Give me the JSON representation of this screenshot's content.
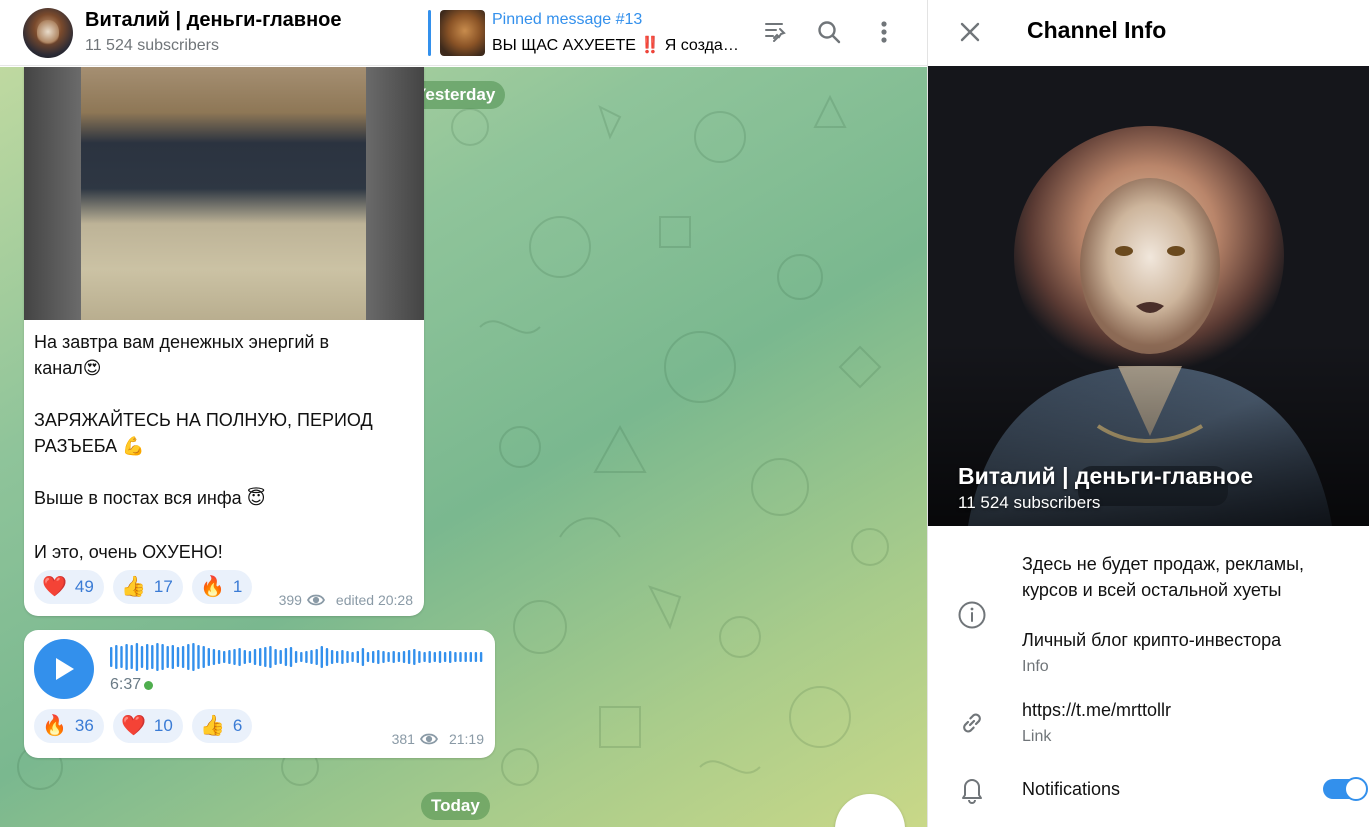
{
  "header": {
    "channel_title": "Виталий | деньги-главное",
    "subscribers": "11 524 subscribers",
    "pinned_title": "Pinned message #13",
    "pinned_text": "ВЫ ЩАС АХУЕЕТЕ ‼️ Я создал…",
    "icons": [
      "unpin-icon",
      "search-icon",
      "more-vertical-icon"
    ]
  },
  "chat": {
    "date_yesterday": "Yesterday",
    "date_today": "Today",
    "post1": {
      "line1": "На завтра вам денежных энергий в",
      "line2": "канал😍",
      "line3": "ЗАРЯЖАЙТЕСЬ НА ПОЛНУЮ, ПЕРИОД",
      "line4": "РАЗЪЕБА 💪",
      "line5": "Выше в постах вся инфа 😇",
      "line6": "И это, очень ОХУЕНО!",
      "reactions": [
        {
          "emoji": "❤️",
          "count": "49"
        },
        {
          "emoji": "👍",
          "count": "17"
        },
        {
          "emoji": "🔥",
          "count": "1"
        }
      ],
      "views": "399",
      "time": "edited 20:28"
    },
    "post2": {
      "duration": "6:37",
      "reactions": [
        {
          "emoji": "🔥",
          "count": "36"
        },
        {
          "emoji": "❤️",
          "count": "10"
        },
        {
          "emoji": "👍",
          "count": "6"
        }
      ],
      "views": "381",
      "time": "21:19"
    }
  },
  "panel": {
    "title": "Channel Info",
    "hero_title": "Виталий | деньги-главное",
    "hero_subs": "11 524 subscribers",
    "info_line1": "Здесь не будет продаж, рекламы,",
    "info_line2": "курсов и всей остальной хуеты",
    "info_line3": "Личный блог крипто-инвестора",
    "info_label": "Info",
    "link": "https://t.me/mrttollr",
    "link_label": "Link",
    "notifications": "Notifications",
    "notifications_on": true
  },
  "colors": {
    "accent": "#3390ec",
    "chat_bg": "#8fc49a",
    "reaction_bg": "#eaf1fb"
  }
}
